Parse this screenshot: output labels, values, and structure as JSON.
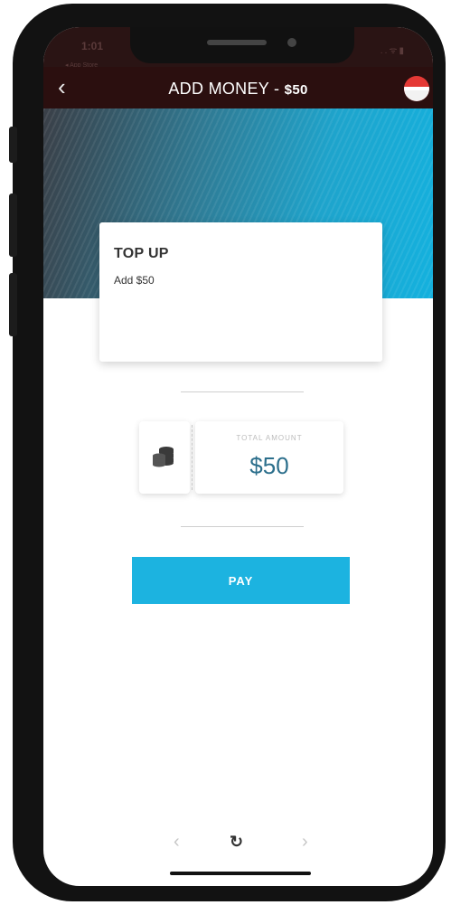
{
  "status_bar": {
    "time": "1:01",
    "back_app": "◂ App Store",
    "icons": "..ᯤ▮"
  },
  "nav": {
    "back_icon": "‹",
    "title": "ADD MONEY - ",
    "title_amount": "$50"
  },
  "card": {
    "title": "TOP UP",
    "subtitle": "Add $50"
  },
  "ticket": {
    "label": "TOTAL AMOUNT",
    "value": "$50"
  },
  "pay_label": "PAY",
  "bottom_nav": {
    "prev": "‹",
    "reload": "↻",
    "next": "›"
  },
  "colors": {
    "nav": "#2b0f0f",
    "accent": "#1cb3e0",
    "amount": "#2c6f8c",
    "badge": "#e53935"
  }
}
